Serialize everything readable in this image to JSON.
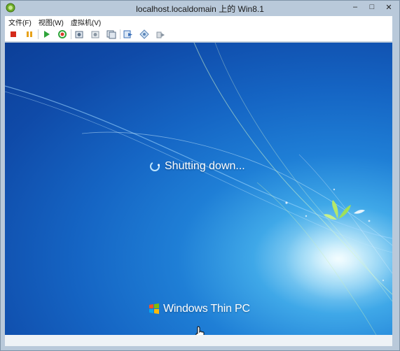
{
  "window": {
    "title": "localhost.localdomain 上的 Win8.1",
    "minimize_icon": "minimize-icon",
    "maximize_icon": "maximize-icon",
    "close_icon": "close-icon"
  },
  "menubar": {
    "items": [
      {
        "label": "文件(F)"
      },
      {
        "label": "视图(W)"
      },
      {
        "label": "虚拟机(V)"
      }
    ]
  },
  "toolbar": {
    "buttons": [
      {
        "icon": "power-off-icon",
        "color": "#d42a1a"
      },
      {
        "icon": "suspend-icon",
        "color": "#e8a21a"
      },
      {
        "icon": "power-on-icon",
        "color": "#2fa43a"
      },
      {
        "icon": "reset-icon",
        "color": "#d83a2a"
      },
      {
        "icon": "snapshot-icon",
        "color": "#5b6f86"
      },
      {
        "icon": "revert-snapshot-icon",
        "color": "#8a96a3"
      },
      {
        "icon": "snapshot-manager-icon",
        "color": "#5b6f86"
      },
      {
        "icon": "send-ctrl-alt-del-icon",
        "color": "#3a6fb8"
      },
      {
        "icon": "vm-settings-icon",
        "color": "#5b86b8"
      },
      {
        "icon": "connect-devices-icon",
        "color": "#8a96a3"
      }
    ]
  },
  "screen": {
    "status": "Shutting down...",
    "brand": "Windows Thin PC",
    "background_color": "#1565c4"
  }
}
